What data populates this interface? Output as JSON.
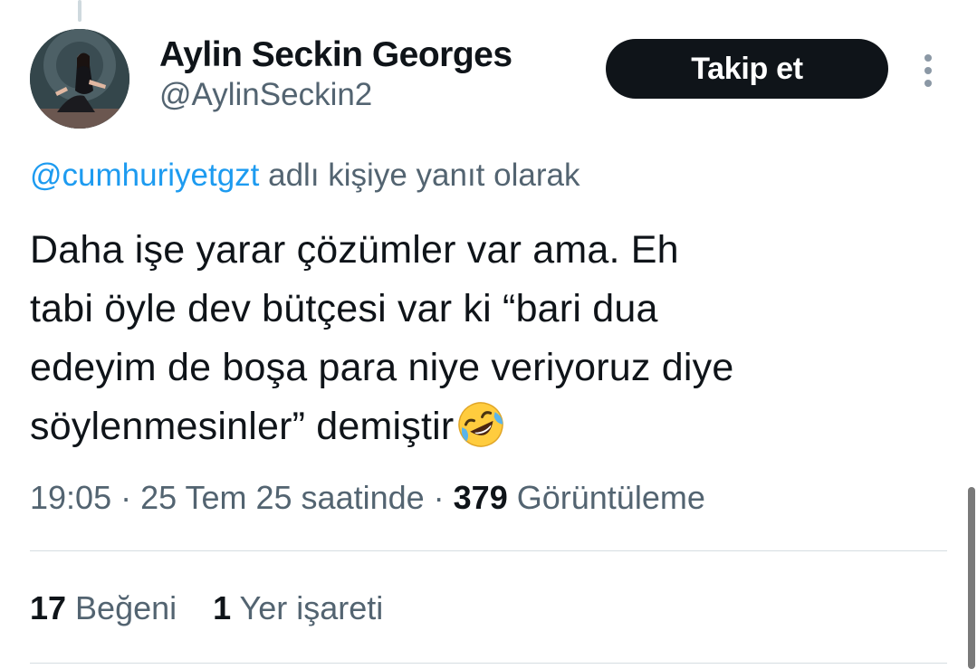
{
  "author": {
    "display_name": "Aylin Seckin Georges",
    "handle": "@AylinSeckin2"
  },
  "actions": {
    "follow_label": "Takip et"
  },
  "reply": {
    "mention": "@cumhuriyetgzt",
    "suffix": " adlı kişiye yanıt olarak"
  },
  "tweet": {
    "lines": [
      "Daha işe yarar çözümler var ama. Eh",
      "tabi öyle dev bütçesi var ki “bari dua",
      "edeyim de boşa para niye veriyoruz diye",
      "söylenmesinler” demiştir"
    ],
    "emoji": "rolling-on-floor-laughing"
  },
  "meta": {
    "time": "19:05",
    "separator": " · ",
    "date": "25 Tem 25 saatinde",
    "views_count": "379",
    "views_label": " Görüntüleme"
  },
  "stats": {
    "likes_count": "17",
    "likes_label": " Beğeni",
    "bookmarks_count": "1",
    "bookmarks_label": " Yer işareti"
  },
  "colors": {
    "link": "#1d9bf0",
    "secondary_text": "#536471",
    "primary_text": "#0f1419",
    "button_bg": "#0f1419"
  }
}
